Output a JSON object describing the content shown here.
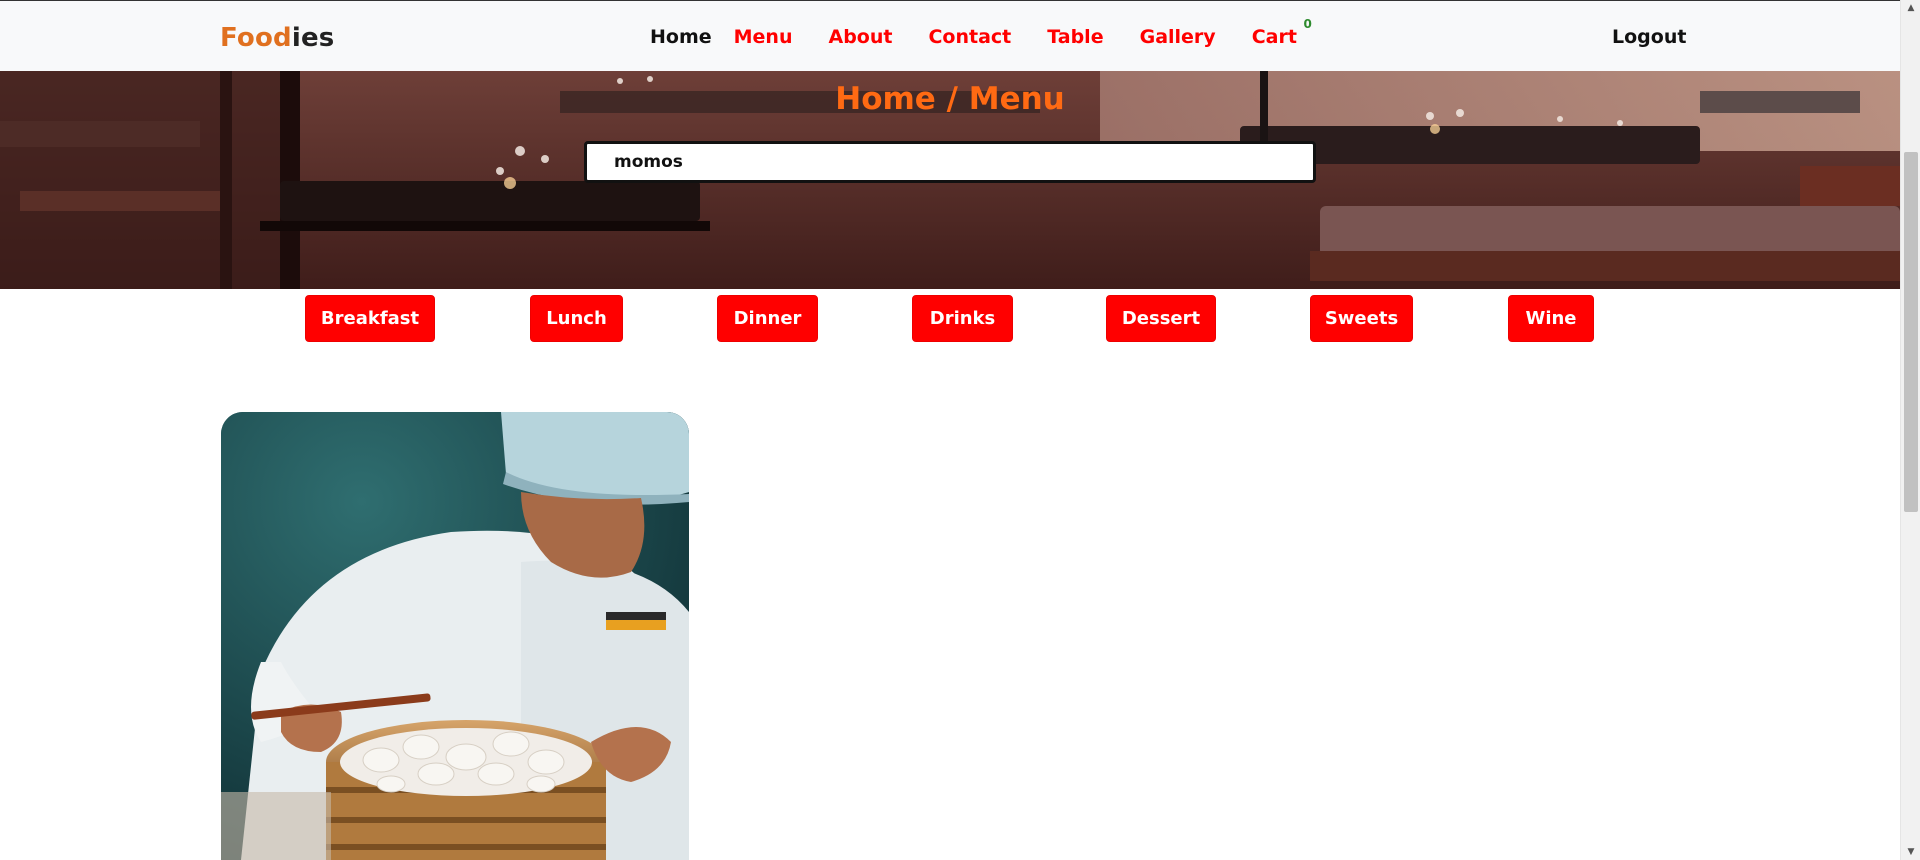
{
  "navbar": {
    "brand_part1": "Food",
    "brand_part2": "ies",
    "links": [
      {
        "label": "Home"
      },
      {
        "label": "Menu"
      },
      {
        "label": "About"
      },
      {
        "label": "Contact"
      },
      {
        "label": "Table"
      },
      {
        "label": "Gallery"
      },
      {
        "label": "Cart"
      }
    ],
    "cart_count": "0",
    "logout_label": "Logout"
  },
  "hero": {
    "breadcrumb": "Home / Menu",
    "search_value": "momos"
  },
  "categories": [
    {
      "label": "Breakfast"
    },
    {
      "label": "Lunch"
    },
    {
      "label": "Dinner"
    },
    {
      "label": "Drinks"
    },
    {
      "label": "Dessert"
    },
    {
      "label": "Sweets"
    },
    {
      "label": "Wine"
    }
  ],
  "colors": {
    "brand_orange": "#e0701f",
    "accent_red": "#ff0000",
    "breadcrumb_orange": "#ff6a13",
    "cart_badge_green": "#2e8b2e"
  }
}
